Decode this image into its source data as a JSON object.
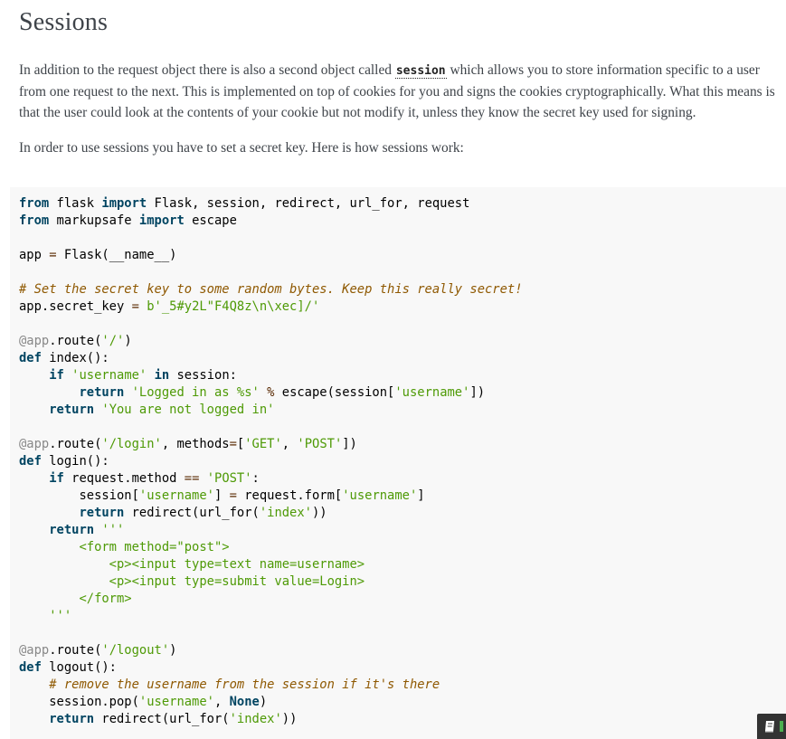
{
  "heading": "Sessions",
  "paragraph1": {
    "before": "In addition to the request object there is also a second object called ",
    "code": "session",
    "after": " which allows you to store information specific to a user from one request to the next. This is implemented on top of cookies for you and signs the cookies cryptographically. What this means is that the user could look at the contents of your cookie but not modify it, unless they know the secret key used for signing."
  },
  "paragraph2": "In order to use sessions you have to set a secret key. Here is how sessions work:",
  "code_lines": [
    [
      [
        "k",
        "from"
      ],
      [
        "t",
        " flask "
      ],
      [
        "k",
        "import"
      ],
      [
        "t",
        " Flask, session, redirect, url_for, request"
      ]
    ],
    [
      [
        "k",
        "from"
      ],
      [
        "t",
        " markupsafe "
      ],
      [
        "k",
        "import"
      ],
      [
        "t",
        " escape"
      ]
    ],
    [],
    [
      [
        "t",
        "app "
      ],
      [
        "o",
        "="
      ],
      [
        "t",
        " Flask(__name__)"
      ]
    ],
    [],
    [
      [
        "c",
        "# Set the secret key to some random bytes. Keep this really secret!"
      ]
    ],
    [
      [
        "t",
        "app.secret_key "
      ],
      [
        "o",
        "="
      ],
      [
        "t",
        " "
      ],
      [
        "s",
        "b'_5#y2L\"F4Q8z\\n\\xec]/'"
      ]
    ],
    [],
    [
      [
        "d",
        "@app"
      ],
      [
        "t",
        ".route("
      ],
      [
        "s",
        "'/'"
      ],
      [
        "t",
        ")"
      ]
    ],
    [
      [
        "k",
        "def"
      ],
      [
        "t",
        " index():"
      ]
    ],
    [
      [
        "t",
        "    "
      ],
      [
        "k",
        "if"
      ],
      [
        "t",
        " "
      ],
      [
        "s",
        "'username'"
      ],
      [
        "t",
        " "
      ],
      [
        "k",
        "in"
      ],
      [
        "t",
        " session:"
      ]
    ],
    [
      [
        "t",
        "        "
      ],
      [
        "k",
        "return"
      ],
      [
        "t",
        " "
      ],
      [
        "s",
        "'Logged in as %s'"
      ],
      [
        "t",
        " "
      ],
      [
        "o",
        "%"
      ],
      [
        "t",
        " escape(session["
      ],
      [
        "s",
        "'username'"
      ],
      [
        "t",
        "])"
      ]
    ],
    [
      [
        "t",
        "    "
      ],
      [
        "k",
        "return"
      ],
      [
        "t",
        " "
      ],
      [
        "s",
        "'You are not logged in'"
      ]
    ],
    [],
    [
      [
        "d",
        "@app"
      ],
      [
        "t",
        ".route("
      ],
      [
        "s",
        "'/login'"
      ],
      [
        "t",
        ", methods"
      ],
      [
        "o",
        "="
      ],
      [
        "t",
        "["
      ],
      [
        "s",
        "'GET'"
      ],
      [
        "t",
        ", "
      ],
      [
        "s",
        "'POST'"
      ],
      [
        "t",
        "])"
      ]
    ],
    [
      [
        "k",
        "def"
      ],
      [
        "t",
        " login():"
      ]
    ],
    [
      [
        "t",
        "    "
      ],
      [
        "k",
        "if"
      ],
      [
        "t",
        " request.method "
      ],
      [
        "o",
        "=="
      ],
      [
        "t",
        " "
      ],
      [
        "s",
        "'POST'"
      ],
      [
        "t",
        ":"
      ]
    ],
    [
      [
        "t",
        "        session["
      ],
      [
        "s",
        "'username'"
      ],
      [
        "t",
        "] "
      ],
      [
        "o",
        "="
      ],
      [
        "t",
        " request.form["
      ],
      [
        "s",
        "'username'"
      ],
      [
        "t",
        "]"
      ]
    ],
    [
      [
        "t",
        "        "
      ],
      [
        "k",
        "return"
      ],
      [
        "t",
        " redirect(url_for("
      ],
      [
        "s",
        "'index'"
      ],
      [
        "t",
        "))"
      ]
    ],
    [
      [
        "t",
        "    "
      ],
      [
        "k",
        "return"
      ],
      [
        "t",
        " "
      ],
      [
        "s",
        "'''"
      ]
    ],
    [
      [
        "s",
        "        <form method=\"post\">"
      ]
    ],
    [
      [
        "s",
        "            <p><input type=text name=username>"
      ]
    ],
    [
      [
        "s",
        "            <p><input type=submit value=Login>"
      ]
    ],
    [
      [
        "s",
        "        </form>"
      ]
    ],
    [
      [
        "s",
        "    '''"
      ]
    ],
    [],
    [
      [
        "d",
        "@app"
      ],
      [
        "t",
        ".route("
      ],
      [
        "s",
        "'/logout'"
      ],
      [
        "t",
        ")"
      ]
    ],
    [
      [
        "k",
        "def"
      ],
      [
        "t",
        " logout():"
      ]
    ],
    [
      [
        "t",
        "    "
      ],
      [
        "c",
        "# remove the username from the session if it's there"
      ]
    ],
    [
      [
        "t",
        "    session.pop("
      ],
      [
        "s",
        "'username'"
      ],
      [
        "t",
        ", "
      ],
      [
        "k",
        "None"
      ],
      [
        "t",
        ")"
      ]
    ],
    [
      [
        "t",
        "    "
      ],
      [
        "k",
        "return"
      ],
      [
        "t",
        " redirect(url_for("
      ],
      [
        "s",
        "'index'"
      ],
      [
        "t",
        "))"
      ]
    ]
  ],
  "colors": {
    "keyword": "#004461",
    "string": "#4e9a06",
    "comment": "#8f5902",
    "decorator": "#888888",
    "code_background": "#f8f8f8",
    "body_text": "#3e4349"
  },
  "icons": {
    "corner_badge": "book-icon"
  }
}
